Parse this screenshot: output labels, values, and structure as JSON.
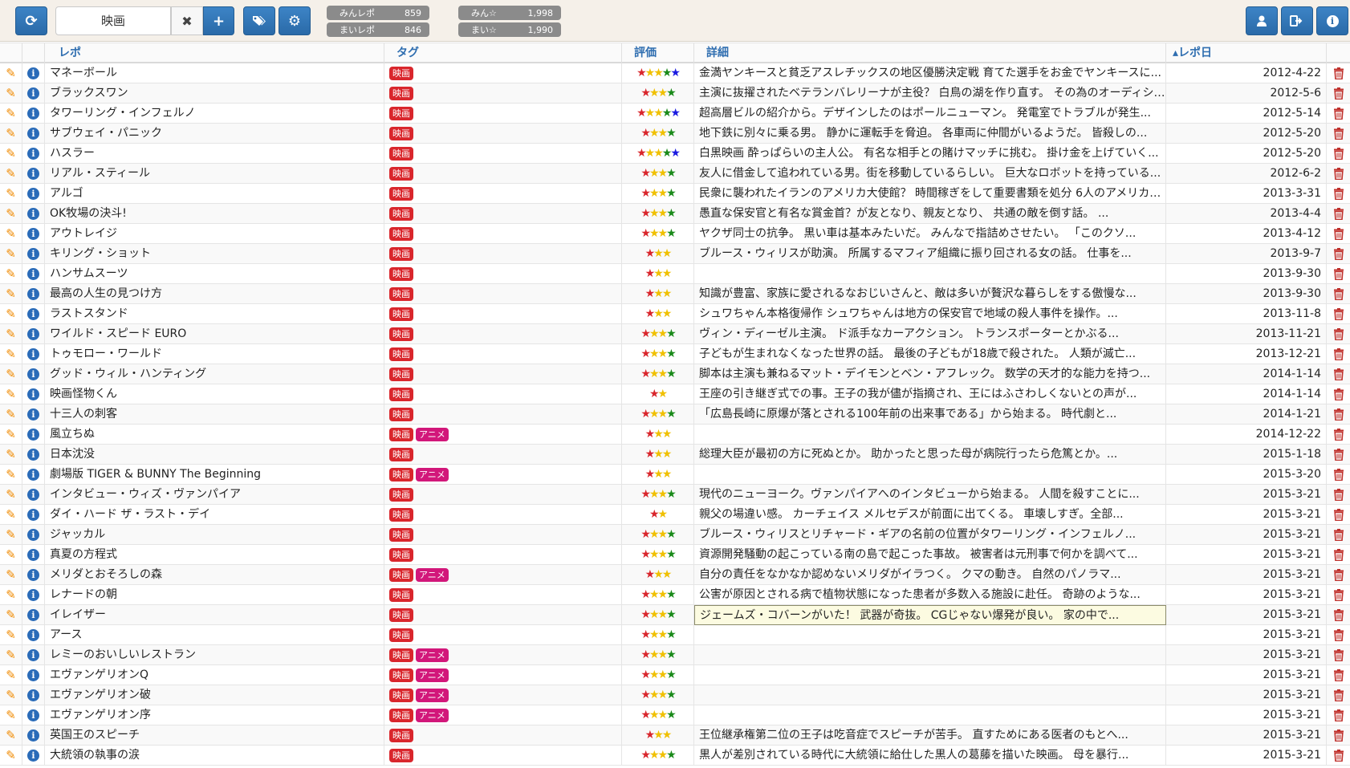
{
  "toolbar": {
    "search_value": "映画",
    "clear_label": "✖",
    "add_label": "+",
    "stats": [
      {
        "label": "みんレポ",
        "value": "859"
      },
      {
        "label": "まいレポ",
        "value": "846"
      },
      {
        "label": "みん☆",
        "value": "1,998"
      },
      {
        "label": "まい☆",
        "value": "1,990"
      }
    ]
  },
  "colors": {
    "accent": "#2a6aa8",
    "tag_movie": "#d9262c",
    "tag_anime": "#d2177a",
    "edit_icon": "#f08a00",
    "delete_icon": "#c0302b"
  },
  "columns": {
    "title": "レポ",
    "tags": "タグ",
    "rating": "評価",
    "detail": "詳細",
    "date": "▴レポ日"
  },
  "rows": [
    {
      "title": "マネーボール",
      "tags": [
        "映画"
      ],
      "stars": [
        "#d9262c",
        "#f0c000",
        "#f0c000",
        "#1a8a1a",
        "#1a1ae0"
      ],
      "detail": "金満ヤンキースと貧乏アスレチックスの地区優勝決定戦 育てた選手をお金でヤンキースに...",
      "date": "2012-4-22"
    },
    {
      "title": "ブラックスワン",
      "tags": [
        "映画"
      ],
      "stars": [
        "#d9262c",
        "#f0c000",
        "#f0c000",
        "#1a8a1a"
      ],
      "detail": "主演に抜擢されたベテランバレリーナが主役？ 白鳥の湖を作り直す。 その為のオーディション...",
      "date": "2012-5-6"
    },
    {
      "title": "タワーリング・インフェルノ",
      "tags": [
        "映画"
      ],
      "stars": [
        "#d9262c",
        "#f0c000",
        "#f0c000",
        "#1a8a1a",
        "#1a1ae0"
      ],
      "detail": "超高層ビルの紹介から。デザインしたのはポールニューマン。 発電室でトラブルが発生...",
      "date": "2012-5-14"
    },
    {
      "title": "サブウェイ・パニック",
      "tags": [
        "映画"
      ],
      "stars": [
        "#d9262c",
        "#f0c000",
        "#f0c000",
        "#1a8a1a"
      ],
      "detail": "地下鉄に別々に乗る男。 静かに運転手を脅迫。 各車両に仲間がいるようだ。 皆殺しの...",
      "date": "2012-5-20"
    },
    {
      "title": "ハスラー",
      "tags": [
        "映画"
      ],
      "stars": [
        "#d9262c",
        "#f0c000",
        "#f0c000",
        "#1a8a1a",
        "#1a1ae0"
      ],
      "detail": "白黒映画 酔っぱらいの主人公。 有名な相手との賭けマッチに挑む。 掛け金を上げていく...",
      "date": "2012-5-20"
    },
    {
      "title": "リアル・スティール",
      "tags": [
        "映画"
      ],
      "stars": [
        "#d9262c",
        "#f0c000",
        "#f0c000",
        "#1a8a1a"
      ],
      "detail": "友人に借金して追われている男。街を移動しているらしい。 巨大なロボットを持っている...",
      "date": "2012-6-2"
    },
    {
      "title": "アルゴ",
      "tags": [
        "映画"
      ],
      "stars": [
        "#d9262c",
        "#f0c000",
        "#f0c000",
        "#1a8a1a"
      ],
      "detail": "民衆に襲われたイランのアメリカ大使館？ 時間稼ぎをして重要書類を処分 6人のアメリカ人...",
      "date": "2013-3-31"
    },
    {
      "title": "OK牧場の決斗!",
      "tags": [
        "映画"
      ],
      "stars": [
        "#d9262c",
        "#f0c000",
        "#f0c000",
        "#1a8a1a"
      ],
      "detail": "愚直な保安官と有名な賞金首？が友となり、親友となり、 共通の敵を倒す話。 ...",
      "date": "2013-4-4"
    },
    {
      "title": "アウトレイジ",
      "tags": [
        "映画"
      ],
      "stars": [
        "#d9262c",
        "#f0c000",
        "#f0c000",
        "#1a8a1a"
      ],
      "detail": "ヤクザ同士の抗争。 黒い車は基本みたいだ。 みんなで指詰めさせたい。 「このクソ...",
      "date": "2013-4-12"
    },
    {
      "title": "キリング・ショット",
      "tags": [
        "映画"
      ],
      "stars": [
        "#d9262c",
        "#f0c000",
        "#f0c000"
      ],
      "detail": "ブルース・ウィリスが助演。 所属するマフィア組織に振り回される女の話。 仕事を...",
      "date": "2013-9-7"
    },
    {
      "title": "ハンサムスーツ",
      "tags": [
        "映画"
      ],
      "stars": [
        "#d9262c",
        "#f0c000",
        "#f0c000"
      ],
      "detail": "",
      "date": "2013-9-30"
    },
    {
      "title": "最高の人生の見つけ方",
      "tags": [
        "映画"
      ],
      "stars": [
        "#d9262c",
        "#f0c000",
        "#f0c000"
      ],
      "detail": "知識が豊富、家族に愛されるなおじいさんと、敵は多いが贅沢な暮らしをする傲慢な...",
      "date": "2013-9-30"
    },
    {
      "title": "ラストスタンド",
      "tags": [
        "映画"
      ],
      "stars": [
        "#d9262c",
        "#f0c000",
        "#f0c000"
      ],
      "detail": "シュワちゃん本格復帰作 シュワちゃんは地方の保安官で地域の殺人事件を操作。...",
      "date": "2013-11-8"
    },
    {
      "title": "ワイルド・スピード EURO",
      "tags": [
        "映画"
      ],
      "stars": [
        "#d9262c",
        "#f0c000",
        "#f0c000",
        "#1a8a1a"
      ],
      "detail": "ヴィン・ディーゼル主演。 ド派手なカーアクション。 トランスポーターとかぶる...",
      "date": "2013-11-21"
    },
    {
      "title": "トゥモロー・ワールド",
      "tags": [
        "映画"
      ],
      "stars": [
        "#d9262c",
        "#f0c000",
        "#f0c000",
        "#1a8a1a"
      ],
      "detail": "子どもが生まれなくなった世界の話。 最後の子どもが18歳で殺された。 人類が滅亡...",
      "date": "2013-12-21"
    },
    {
      "title": "グッド・ウィル・ハンティング",
      "tags": [
        "映画"
      ],
      "stars": [
        "#d9262c",
        "#f0c000",
        "#f0c000",
        "#1a8a1a"
      ],
      "detail": "脚本は主演も兼ねるマット・デイモンとベン・アフレック。 数学の天才的な能力を持つ...",
      "date": "2014-1-14"
    },
    {
      "title": "映画怪物くん",
      "tags": [
        "映画"
      ],
      "stars": [
        "#d9262c",
        "#f0c000"
      ],
      "detail": "王座の引き継ぎ式での事。王子の我が儘が指摘され、王にはふさわしくないとの声が...",
      "date": "2014-1-14"
    },
    {
      "title": "十三人の刺客",
      "tags": [
        "映画"
      ],
      "stars": [
        "#d9262c",
        "#f0c000",
        "#f0c000",
        "#1a8a1a"
      ],
      "detail": "「広島長崎に原爆が落とされる100年前の出来事である」から始まる。 時代劇と...",
      "date": "2014-1-21"
    },
    {
      "title": "風立ちぬ",
      "tags": [
        "映画",
        "アニメ"
      ],
      "stars": [
        "#d9262c",
        "#f0c000",
        "#f0c000"
      ],
      "detail": "",
      "date": "2014-12-22"
    },
    {
      "title": "日本沈没",
      "tags": [
        "映画"
      ],
      "stars": [
        "#d9262c",
        "#f0c000",
        "#f0c000"
      ],
      "detail": "総理大臣が最初の方に死ぬとか。 助かったと思った母が病院行ったら危篤とか。...",
      "date": "2015-1-18"
    },
    {
      "title": "劇場版 TIGER & BUNNY The Beginning",
      "tags": [
        "映画",
        "アニメ"
      ],
      "stars": [
        "#d9262c",
        "#f0c000",
        "#f0c000"
      ],
      "detail": "",
      "date": "2015-3-20"
    },
    {
      "title": "インタビュー・ウィズ・ヴァンパイア",
      "tags": [
        "映画"
      ],
      "stars": [
        "#d9262c",
        "#f0c000",
        "#f0c000",
        "#1a8a1a"
      ],
      "detail": "現代のニューヨーク。ヴァンパイアへのインタビューから始まる。 人間を殺すことに...",
      "date": "2015-3-21"
    },
    {
      "title": "ダイ・ハード ザ・ラスト・デイ",
      "tags": [
        "映画"
      ],
      "stars": [
        "#d9262c",
        "#f0c000"
      ],
      "detail": "親父の場違い感。 カーチェイス メルセデスが前面に出てくる。 車壊しすぎ。全部...",
      "date": "2015-3-21"
    },
    {
      "title": "ジャッカル",
      "tags": [
        "映画"
      ],
      "stars": [
        "#d9262c",
        "#f0c000",
        "#f0c000",
        "#1a8a1a"
      ],
      "detail": "ブルース・ウィリスとリチャード・ギアの名前の位置がタワーリング・インフェルノ...",
      "date": "2015-3-21"
    },
    {
      "title": "真夏の方程式",
      "tags": [
        "映画"
      ],
      "stars": [
        "#d9262c",
        "#f0c000",
        "#f0c000",
        "#1a8a1a"
      ],
      "detail": "資源開発騒動の起こっている南の島で起こった事故。 被害者は元刑事で何かを調べて...",
      "date": "2015-3-21"
    },
    {
      "title": "メリダとおそろしの森",
      "tags": [
        "映画",
        "アニメ"
      ],
      "stars": [
        "#d9262c",
        "#f0c000",
        "#f0c000"
      ],
      "detail": "自分の責任をなかなか認めないメリダがイラつく。 クマの動き。 自然のパノラマ...",
      "date": "2015-3-21"
    },
    {
      "title": "レナードの朝",
      "tags": [
        "映画"
      ],
      "stars": [
        "#d9262c",
        "#f0c000",
        "#f0c000",
        "#1a8a1a"
      ],
      "detail": "公害が原因とされる病で植物状態になった患者が多数入る施設に赴任。 奇跡のような...",
      "date": "2015-3-21"
    },
    {
      "title": "イレイザー",
      "tags": [
        "映画"
      ],
      "stars": [
        "#d9262c",
        "#f0c000",
        "#f0c000",
        "#1a8a1a"
      ],
      "detail": "ジェームズ・コバーンがいた！ 武器が奇抜。 CGじゃない爆発が良い。 家の中で...",
      "date": "2015-3-21",
      "highlight": true
    },
    {
      "title": "アース",
      "tags": [
        "映画"
      ],
      "stars": [
        "#d9262c",
        "#f0c000",
        "#f0c000",
        "#1a8a1a"
      ],
      "detail": "",
      "date": "2015-3-21"
    },
    {
      "title": "レミーのおいしいレストラン",
      "tags": [
        "映画",
        "アニメ"
      ],
      "stars": [
        "#d9262c",
        "#f0c000",
        "#f0c000",
        "#1a8a1a"
      ],
      "detail": "",
      "date": "2015-3-21"
    },
    {
      "title": "エヴァンゲリオンQ",
      "tags": [
        "映画",
        "アニメ"
      ],
      "stars": [
        "#d9262c",
        "#f0c000",
        "#f0c000",
        "#1a8a1a"
      ],
      "detail": "",
      "date": "2015-3-21"
    },
    {
      "title": "エヴァンゲリオン破",
      "tags": [
        "映画",
        "アニメ"
      ],
      "stars": [
        "#d9262c",
        "#f0c000",
        "#f0c000",
        "#1a8a1a"
      ],
      "detail": "",
      "date": "2015-3-21"
    },
    {
      "title": "エヴァンゲリオン序",
      "tags": [
        "映画",
        "アニメ"
      ],
      "stars": [
        "#d9262c",
        "#f0c000",
        "#f0c000",
        "#1a8a1a"
      ],
      "detail": "",
      "date": "2015-3-21"
    },
    {
      "title": "英国王のスピーチ",
      "tags": [
        "映画"
      ],
      "stars": [
        "#d9262c",
        "#f0c000",
        "#f0c000"
      ],
      "detail": "王位継承権第二位の王子は吃音症でスピーチが苦手。 直すためにある医者のもとへ...",
      "date": "2015-3-21"
    },
    {
      "title": "大統領の執事の涙",
      "tags": [
        "映画"
      ],
      "stars": [
        "#d9262c",
        "#f0c000",
        "#f0c000",
        "#1a8a1a"
      ],
      "detail": "黒人が差別されている時代に大統領に給仕した黒人の葛藤を描いた映画。 母を暴行...",
      "date": "2015-3-21"
    }
  ]
}
